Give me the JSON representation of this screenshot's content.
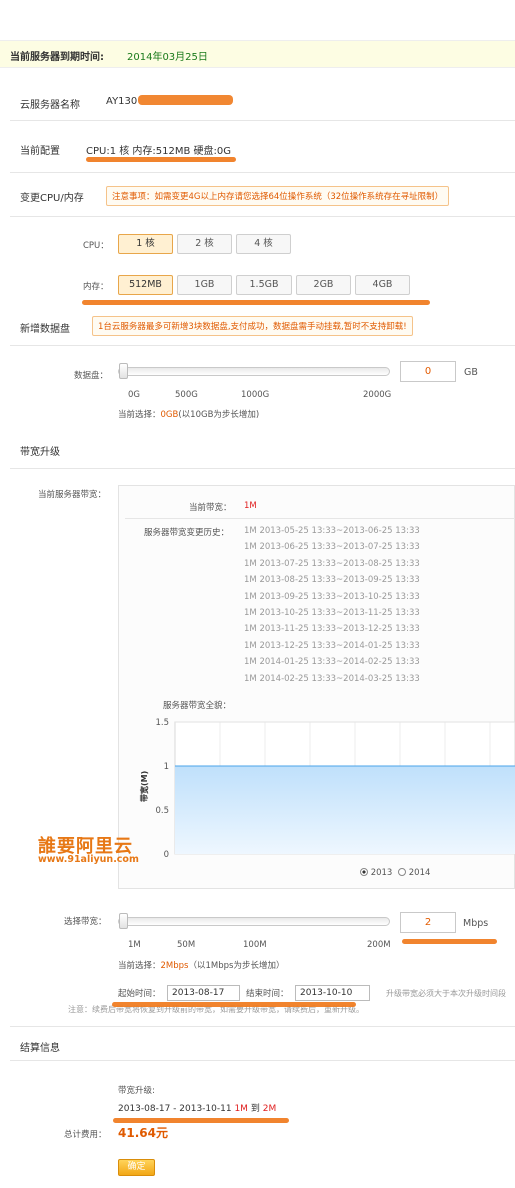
{
  "expiry": {
    "label": "当前服务器到期时间:",
    "date": "2014年03月25日"
  },
  "server_name": {
    "label": "云服务器名称",
    "value": "AY130"
  },
  "current_config": {
    "label": "当前配置",
    "value": "CPU:1 核 内存:512MB 硬盘:0G"
  },
  "change_cpu": {
    "label": "变更CPU/内存",
    "notice": "注意事项：如需变更4G以上内存请您选择64位操作系统（32位操作系统存在寻址限制）",
    "cpu_label": "CPU：",
    "cpu_options": [
      "1 核",
      "2 核",
      "4 核"
    ],
    "cpu_selected": "1 核",
    "mem_label": "内存：",
    "mem_options": [
      "512MB",
      "1GB",
      "1.5GB",
      "2GB",
      "4GB"
    ],
    "mem_selected": "512MB"
  },
  "disk": {
    "label": "新增数据盘",
    "notice": "1台云服务器最多可新增3块数据盘,支付成功，数据盘需手动挂载,暂时不支持卸载!",
    "slider_label": "数据盘：",
    "value": "0",
    "unit": "GB",
    "ticks": [
      "0G",
      "500G",
      "1000G",
      "2000G"
    ],
    "hint_prefix": "当前选择：",
    "hint_value": "0GB",
    "hint_suffix": "(以10GB为步长增加)"
  },
  "bandwidth": {
    "section_label": "带宽升级",
    "current_label": "当前服务器带宽：",
    "inner_current_label": "当前带宽：",
    "inner_current_value": "1M",
    "history_label": "服务器带宽变更历史：",
    "history": [
      "1M 2013-05-25 13:33~2013-06-25 13:33",
      "1M 2013-06-25 13:33~2013-07-25 13:33",
      "1M 2013-07-25 13:33~2013-08-25 13:33",
      "1M 2013-08-25 13:33~2013-09-25 13:33",
      "1M 2013-09-25 13:33~2013-10-25 13:33",
      "1M 2013-10-25 13:33~2013-11-25 13:33",
      "1M 2013-11-25 13:33~2013-12-25 13:33",
      "1M 2013-12-25 13:33~2014-01-25 13:33",
      "1M 2014-01-25 13:33~2014-02-25 13:33",
      "1M 2014-02-25 13:33~2014-03-25 13:33"
    ],
    "overview_label": "服务器带宽全貌：",
    "year_options": [
      "2013",
      "2014"
    ],
    "year_selected": "2013",
    "select_label": "选择带宽：",
    "value": "2",
    "unit": "Mbps",
    "ticks": [
      "1M",
      "50M",
      "100M",
      "200M"
    ],
    "hint_prefix": "当前选择：",
    "hint_value": "2Mbps",
    "hint_suffix": "（以1Mbps为步长增加）",
    "start_label": "起始时间：",
    "start_value": "2013-08-17",
    "end_label": "结束时间：",
    "end_value": "2013-10-10",
    "tail_note": "升级带宽必须大于本次升级时间段",
    "warning": "注意：续费后带宽将恢复到升级前的带宽，如需要升级带宽，请续费后，重新升级。"
  },
  "chart_data": {
    "type": "area",
    "title": "",
    "xlabel": "",
    "ylabel": "带宽(M)",
    "ylim": [
      0,
      1.5
    ],
    "yticks": [
      "1.5",
      "1",
      "0.5",
      "0"
    ],
    "series": [
      {
        "values": [
          1,
          1,
          1,
          1,
          1,
          1,
          1,
          1,
          1,
          1
        ]
      }
    ],
    "grid": true,
    "fill_color": "#bfe0fb",
    "line_color": "#4aa3e8"
  },
  "settlement": {
    "section_label": "结算信息",
    "upgrade_label": "带宽升级:",
    "range": "2013-08-17 - 2013-10-11",
    "from": "1M",
    "to_word": "到",
    "to": "2M",
    "total_label": "总计费用：",
    "total": "41.64元",
    "confirm": "确定"
  },
  "watermark": {
    "line1": "誰要阿里云",
    "line2": "www.91aliyun.com"
  },
  "colors": {
    "accent": "#e05a00",
    "annotation": "#f07a1c",
    "banner_bg": "#fdfde3"
  }
}
